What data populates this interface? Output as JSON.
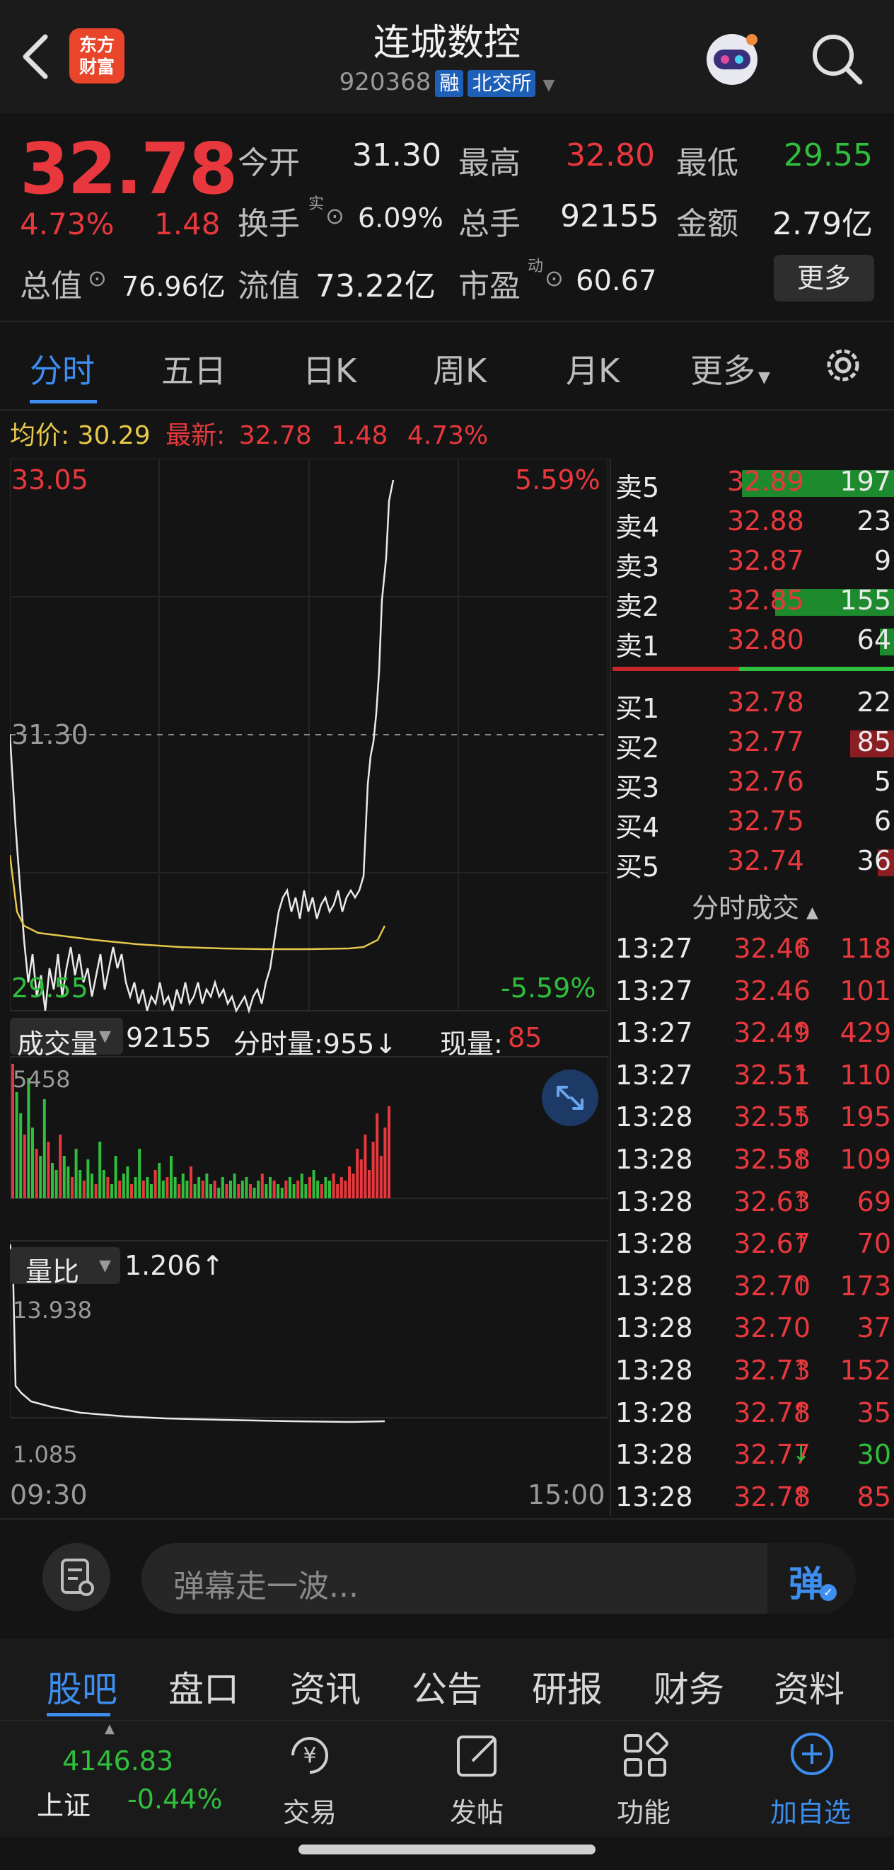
{
  "header": {
    "logo_line1": "东方",
    "logo_line2": "财富",
    "title": "连城数控",
    "code": "920368",
    "tag1": "融",
    "tag2": "北交所"
  },
  "quote": {
    "price": "32.78",
    "pct": "4.73%",
    "change": "1.48",
    "open_label": "今开",
    "open": "31.30",
    "high_label": "最高",
    "high": "32.80",
    "low_label": "最低",
    "low": "29.55",
    "turnover_label": "换手",
    "turnover_sup": "实",
    "turnover": "6.09%",
    "volume_label": "总手",
    "volume": "92155",
    "amount_label": "金额",
    "amount": "2.79亿",
    "mcap_label": "总值",
    "mcap": "76.96亿",
    "float_label": "流值",
    "float": "73.22亿",
    "pe_label": "市盈",
    "pe_sup": "动",
    "pe": "60.67",
    "more": "更多"
  },
  "tabs": [
    "分时",
    "五日",
    "日K",
    "周K",
    "月K",
    "更多"
  ],
  "avg": {
    "avg_label": "均价:",
    "avg": "30.29",
    "latest_label": "最新:",
    "latest": "32.78",
    "chg": "1.48",
    "pct": "4.73%"
  },
  "chart": {
    "y_top": "33.05",
    "y_top_pct": "5.59%",
    "y_ref": "31.30",
    "y_bot": "29.55",
    "y_bot_pct": "-5.59%",
    "vol_label": "成交量",
    "vol_total": "92155",
    "vol_min_label": "分时量:955↓",
    "vol_now_label": "现量:",
    "vol_now": "85",
    "vol_max": "5458",
    "ratio_label": "量比",
    "ratio": "1.206↑",
    "ratio_max": "13.938",
    "ratio_min": "1.085",
    "time_start": "09:30",
    "time_end": "15:00"
  },
  "orderbook": {
    "asks": [
      {
        "label": "卖5",
        "price": "32.89",
        "vol": "197",
        "bar": 0.55
      },
      {
        "label": "卖4",
        "price": "32.88",
        "vol": "23",
        "bar": 0
      },
      {
        "label": "卖3",
        "price": "32.87",
        "vol": "9",
        "bar": 0
      },
      {
        "label": "卖2",
        "price": "32.85",
        "vol": "155",
        "bar": 0.43
      },
      {
        "label": "卖1",
        "price": "32.80",
        "vol": "64",
        "bar": 0.05
      }
    ],
    "bids": [
      {
        "label": "买1",
        "price": "32.78",
        "vol": "22",
        "bar": 0
      },
      {
        "label": "买2",
        "price": "32.77",
        "vol": "85",
        "bar": 0.16
      },
      {
        "label": "买3",
        "price": "32.76",
        "vol": "5",
        "bar": 0
      },
      {
        "label": "买4",
        "price": "32.75",
        "vol": "6",
        "bar": 0
      },
      {
        "label": "买5",
        "price": "32.74",
        "vol": "36",
        "bar": 0.06
      }
    ],
    "ticks_title": "分时成交",
    "ticks": [
      {
        "t": "13:27",
        "p": "32.46",
        "a": "↑",
        "v": "118"
      },
      {
        "t": "13:27",
        "p": "32.46",
        "a": "",
        "v": "101"
      },
      {
        "t": "13:27",
        "p": "32.49",
        "a": "↑",
        "v": "429"
      },
      {
        "t": "13:27",
        "p": "32.51",
        "a": "↑",
        "v": "110"
      },
      {
        "t": "13:28",
        "p": "32.55",
        "a": "↑",
        "v": "195"
      },
      {
        "t": "13:28",
        "p": "32.58",
        "a": "↑",
        "v": "109"
      },
      {
        "t": "13:28",
        "p": "32.63",
        "a": "↑",
        "v": "69"
      },
      {
        "t": "13:28",
        "p": "32.67",
        "a": "↑",
        "v": "70"
      },
      {
        "t": "13:28",
        "p": "32.70",
        "a": "↑",
        "v": "173"
      },
      {
        "t": "13:28",
        "p": "32.70",
        "a": "",
        "v": "37"
      },
      {
        "t": "13:28",
        "p": "32.73",
        "a": "↑",
        "v": "152"
      },
      {
        "t": "13:28",
        "p": "32.78",
        "a": "↑",
        "v": "35"
      },
      {
        "t": "13:28",
        "p": "32.77",
        "a": "↓",
        "v": "30"
      },
      {
        "t": "13:28",
        "p": "32.78",
        "a": "↑",
        "v": "85"
      }
    ]
  },
  "danmu": {
    "placeholder": "弹幕走一波...",
    "btn": "弹"
  },
  "bottom_tabs": [
    "股吧",
    "盘口",
    "资讯",
    "公告",
    "研报",
    "财务",
    "资料"
  ],
  "dock": {
    "index_value": "4146.83",
    "index_name": "上证",
    "index_pct": "-0.44%",
    "items": [
      "交易",
      "发帖",
      "功能",
      "加自选"
    ]
  }
}
